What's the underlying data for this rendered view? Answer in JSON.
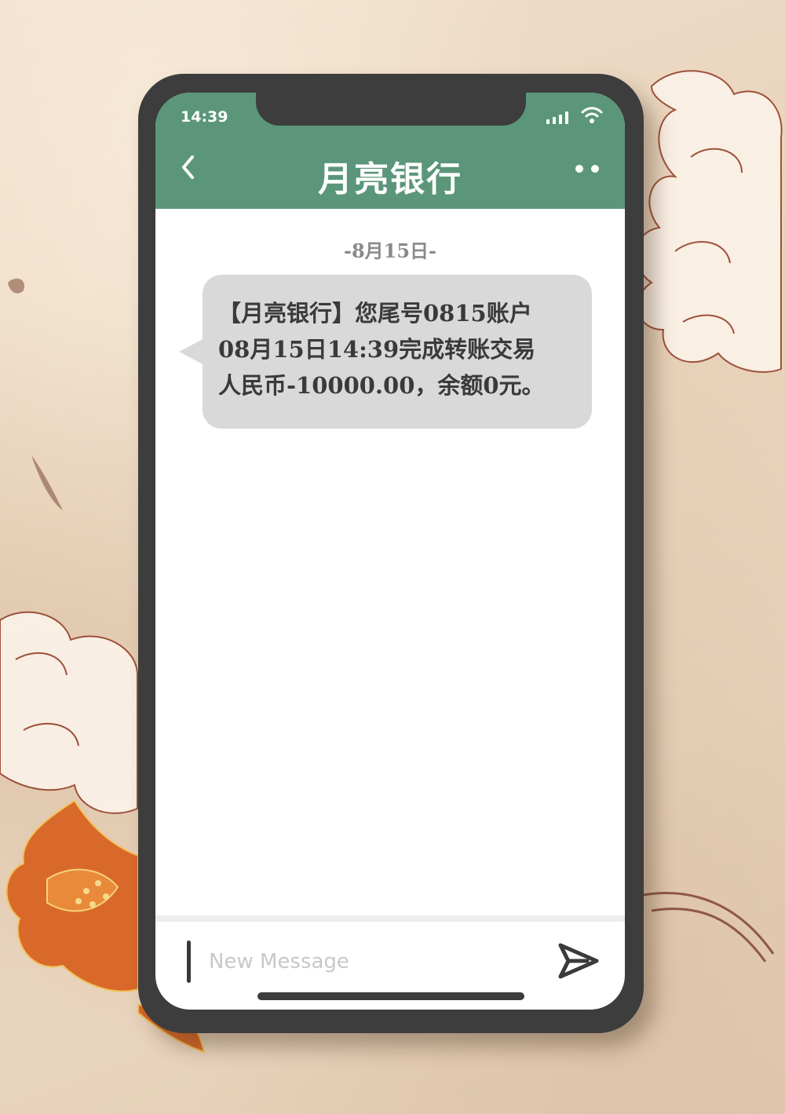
{
  "status_bar": {
    "time": "14:39"
  },
  "header": {
    "title": "月亮银行",
    "color": "#5b967a"
  },
  "conversation": {
    "date_label": "-8月15日-",
    "messages": [
      {
        "text": "【月亮银行】您尾号0815账户\n08月15日14:39完成转账交易\n人民币-10000.00，余额0元。"
      }
    ]
  },
  "composer": {
    "placeholder": "New Message"
  },
  "icons": {
    "back": "chevron-left-icon",
    "more": "more-dots-icon",
    "signal": "signal-bars-icon",
    "wifi": "wifi-icon",
    "send": "send-icon"
  }
}
